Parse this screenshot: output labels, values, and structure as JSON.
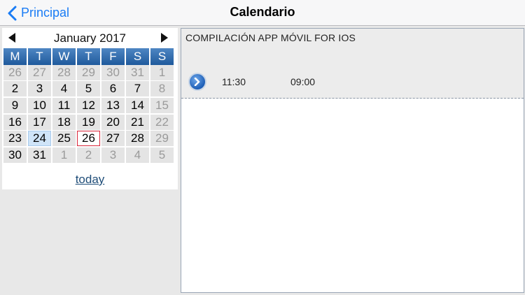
{
  "navbar": {
    "back_label": "Principal",
    "title": "Calendario"
  },
  "calendar": {
    "month_title": "January 2017",
    "weekdays": [
      "M",
      "T",
      "W",
      "T",
      "F",
      "S",
      "S"
    ],
    "weeks": [
      [
        "26",
        "27",
        "28",
        "29",
        "30",
        "31",
        "1"
      ],
      [
        "2",
        "3",
        "4",
        "5",
        "6",
        "7",
        "8"
      ],
      [
        "9",
        "10",
        "11",
        "12",
        "13",
        "14",
        "15"
      ],
      [
        "16",
        "17",
        "18",
        "19",
        "20",
        "21",
        "22"
      ],
      [
        "23",
        "24",
        "25",
        "26",
        "27",
        "28",
        "29"
      ],
      [
        "30",
        "31",
        "1",
        "2",
        "3",
        "4",
        "5"
      ]
    ],
    "today_label": "today",
    "selected_day": "24",
    "current_day": "26"
  },
  "event": {
    "title": "COMPILACIÓN APP MÓVIL FOR IOS",
    "start_time": "11:30",
    "end_time": "09:00"
  },
  "colors": {
    "accent": "#1a7cf5",
    "header_blue": "#1f5a9c",
    "today_border": "#d9263a"
  }
}
